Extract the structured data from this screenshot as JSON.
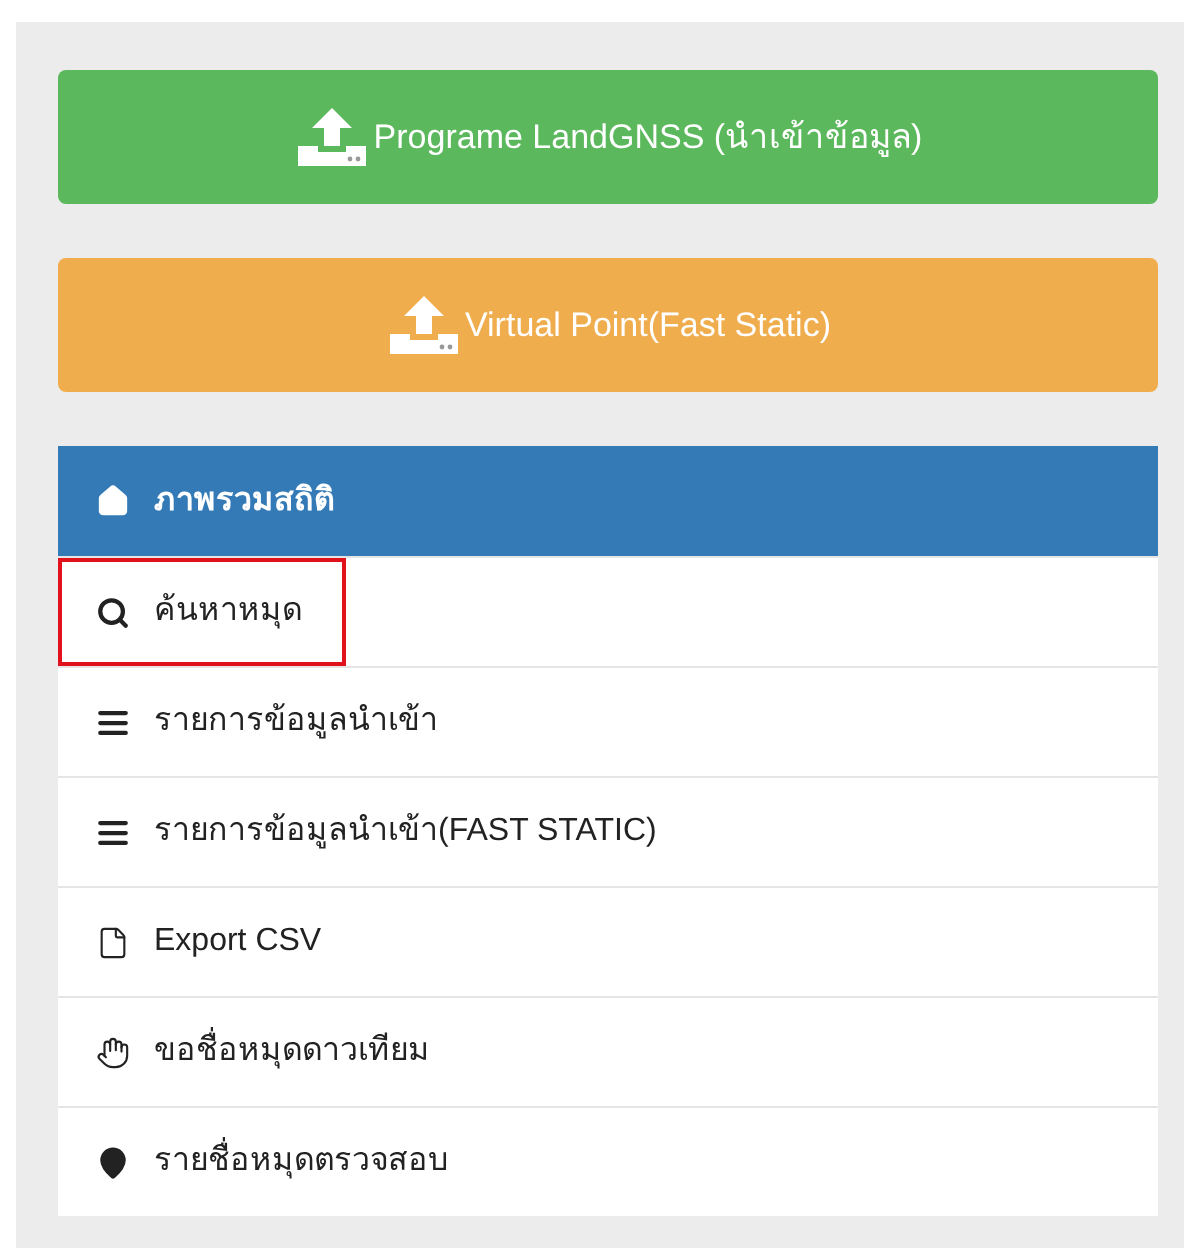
{
  "buttons": [
    {
      "label": "Programe LandGNSS (นำเข้าข้อมูล)",
      "color": "#5cb85c"
    },
    {
      "label": "Virtual Point(Fast Static)",
      "color": "#f0ad4e"
    }
  ],
  "menu": [
    {
      "label": "ภาพรวมสถิติ",
      "kind": "home",
      "selected": true,
      "highlighted": false
    },
    {
      "label": "ค้นหาหมุด",
      "kind": "search",
      "selected": false,
      "highlighted": true
    },
    {
      "label": "รายการข้อมูลนำเข้า",
      "kind": "list",
      "selected": false,
      "highlighted": false
    },
    {
      "label": "รายการข้อมูลนำเข้า(FAST STATIC)",
      "kind": "list",
      "selected": false,
      "highlighted": false
    },
    {
      "label": "Export CSV",
      "kind": "file",
      "selected": false,
      "highlighted": false
    },
    {
      "label": "ขอชื่อหมุดดาวเทียม",
      "kind": "hand",
      "selected": false,
      "highlighted": false
    },
    {
      "label": "รายชื่อหมุดตรวจสอบ",
      "kind": "pin",
      "selected": false,
      "highlighted": false
    }
  ]
}
